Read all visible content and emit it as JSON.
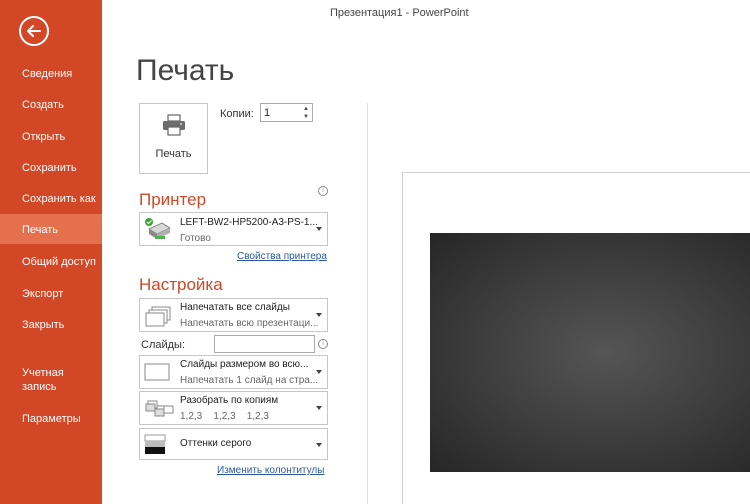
{
  "window": {
    "title": "Презентация1 - PowerPoint"
  },
  "sidebar": {
    "items": [
      {
        "label": "Сведения"
      },
      {
        "label": "Создать"
      },
      {
        "label": "Открыть"
      },
      {
        "label": "Сохранить"
      },
      {
        "label": "Сохранить как"
      },
      {
        "label": "Печать",
        "active": true
      },
      {
        "label": "Общий доступ"
      },
      {
        "label": "Экспорт"
      },
      {
        "label": "Закрыть"
      },
      {
        "label": "Учетная запись"
      },
      {
        "label": "Параметры"
      }
    ]
  },
  "page": {
    "title": "Печать"
  },
  "print_button": {
    "label": "Печать"
  },
  "copies": {
    "label": "Копии:",
    "value": "1"
  },
  "printer": {
    "section_title": "Принтер",
    "name": "LEFT-BW2-HP5200-A3-PS-1...",
    "status": "Готово",
    "properties_link": "Свойства принтера"
  },
  "settings": {
    "section_title": "Настройка",
    "slides_range": {
      "title": "Напечатать все слайды",
      "subtitle": "Напечатать всю презентаци..."
    },
    "slides_label": "Слайды:",
    "slides_value": "",
    "layout": {
      "title": "Слайды размером во всю...",
      "subtitle": "Напечатать 1 слайд на стра..."
    },
    "collate": {
      "title": "Разобрать по копиям",
      "subtitle": "1,2,3    1,2,3    1,2,3"
    },
    "color": {
      "title": "Оттенки серого"
    },
    "header_footer_link": "Изменить колонтитулы"
  },
  "colors": {
    "accent": "#d24726",
    "accent_active": "#e5704e",
    "link": "#2a5a9c"
  }
}
